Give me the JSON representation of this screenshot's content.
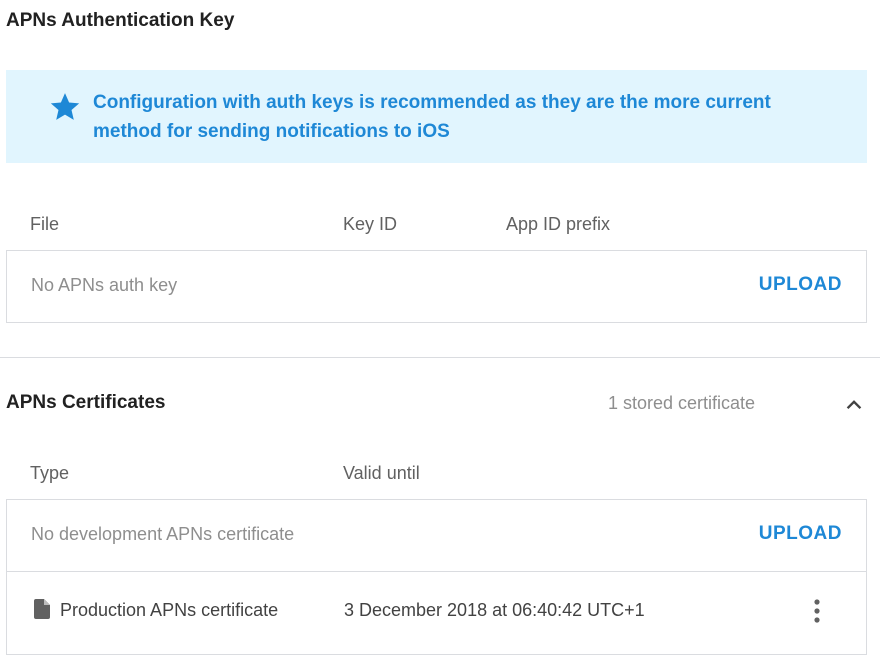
{
  "auth_key": {
    "title": "APNs Authentication Key",
    "banner": {
      "icon": "star-icon",
      "text": "Configuration with auth keys is recommended as they are the more current method for sending notifications to iOS"
    },
    "columns": [
      "File",
      "Key ID",
      "App ID prefix"
    ],
    "empty_text": "No APNs auth key",
    "upload_label": "UPLOAD"
  },
  "certificates": {
    "title": "APNs Certificates",
    "count_text": "1 stored certificate",
    "collapse_icon": "chevron-up-icon",
    "columns": [
      "Type",
      "Valid until"
    ],
    "development": {
      "empty_text": "No development APNs certificate",
      "upload_label": "UPLOAD"
    },
    "production": {
      "icon": "file-icon",
      "name": "Production APNs certificate",
      "valid_until": "3 December 2018 at 06:40:42 UTC+1",
      "menu_icon": "more-vert-icon"
    }
  },
  "colors": {
    "accent": "#1e88d6",
    "banner_bg": "#e1f5fe",
    "border": "#dadce0"
  }
}
